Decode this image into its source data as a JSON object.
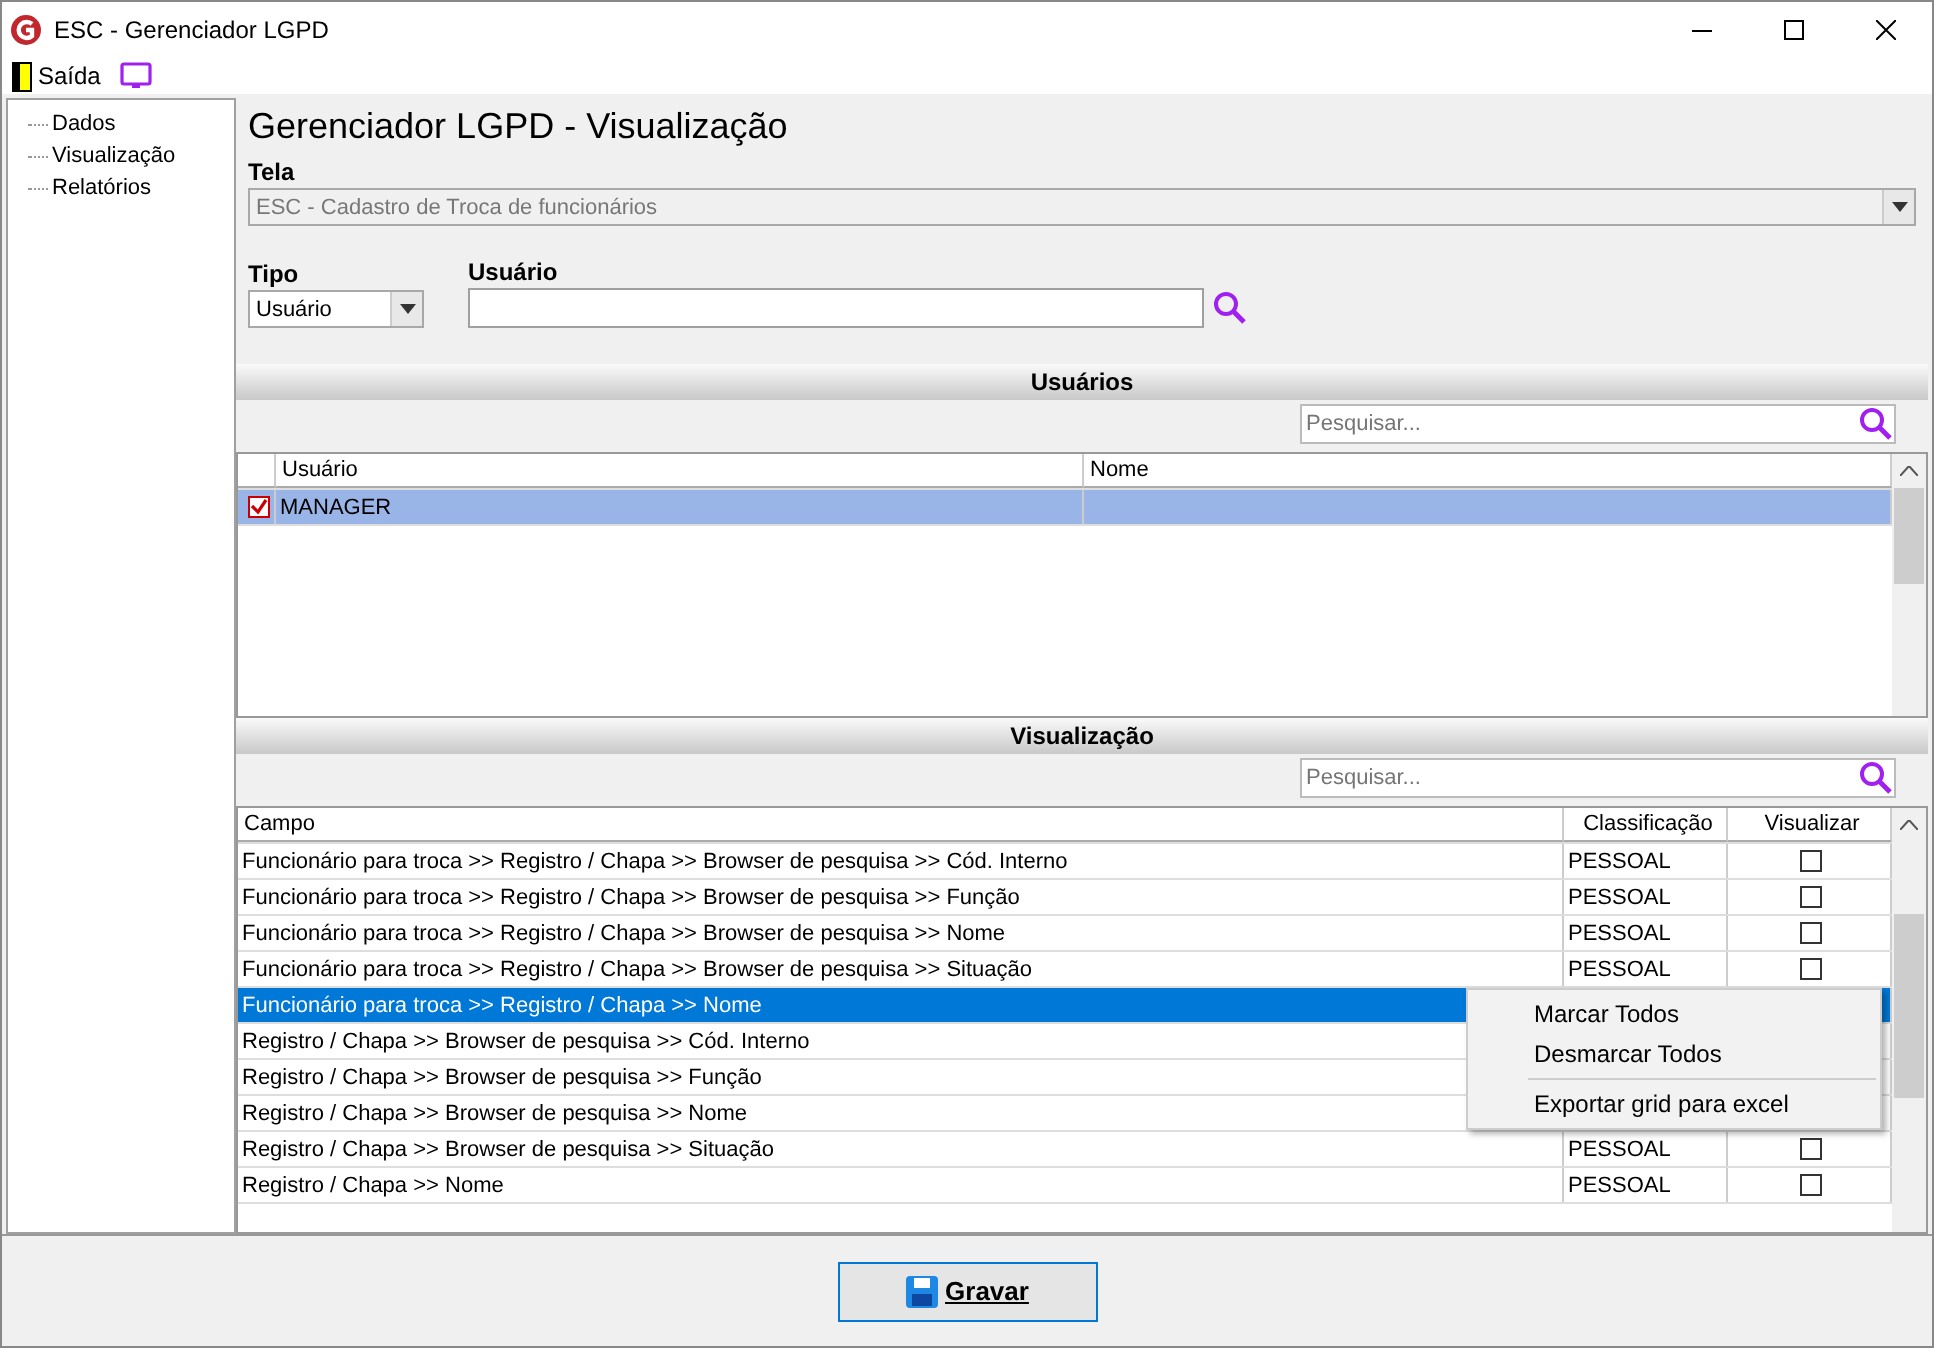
{
  "window": {
    "title": "ESC - Gerenciador LGPD"
  },
  "menu": {
    "label": "Saída"
  },
  "sidebar": {
    "items": [
      {
        "label": "Dados"
      },
      {
        "label": "Visualização"
      },
      {
        "label": "Relatórios"
      }
    ]
  },
  "page_title": "Gerenciador LGPD - Visualização",
  "tela": {
    "label": "Tela",
    "value": "ESC - Cadastro de Troca de funcionários",
    "disabled": true
  },
  "tipo": {
    "label": "Tipo",
    "value": "Usuário"
  },
  "usuario": {
    "label": "Usuário"
  },
  "usuarios": {
    "title": "Usuários",
    "search": {
      "placeholder": "Pesquisar..."
    },
    "columns": [
      "Usuário",
      "Nome"
    ],
    "rows": [
      {
        "usuario": "MANAGER",
        "checked": true,
        "selected": true
      }
    ]
  },
  "visualizacao": {
    "title": "Visualização",
    "search": {
      "placeholder": "Pesquisar..."
    },
    "columns": [
      "Campo",
      "Classificação",
      "Visualizar"
    ],
    "rows": [
      {
        "campo": "Funcionário para troca >> Registro / Chapa  >> Browser de pesquisa >> Cód. Interno",
        "classificacao": "PESSOAL",
        "checked": false,
        "selected": false
      },
      {
        "campo": "Funcionário para troca >> Registro / Chapa  >> Browser de pesquisa >> Função",
        "classificacao": "PESSOAL",
        "checked": false,
        "selected": false
      },
      {
        "campo": "Funcionário para troca >> Registro / Chapa  >> Browser de pesquisa >> Nome",
        "classificacao": "PESSOAL",
        "checked": false,
        "selected": false
      },
      {
        "campo": "Funcionário para troca >> Registro / Chapa  >> Browser de pesquisa >> Situação",
        "classificacao": "PESSOAL",
        "checked": false,
        "selected": false
      },
      {
        "campo": "Funcionário para troca >> Registro / Chapa >> Nome",
        "selected": true
      },
      {
        "campo": "Registro / Chapa >> Browser de pesquisa >> Cód. Interno",
        "selected": false
      },
      {
        "campo": "Registro / Chapa >> Browser de pesquisa >> Função",
        "selected": false
      },
      {
        "campo": "Registro / Chapa >> Browser de pesquisa >> Nome",
        "selected": false
      },
      {
        "campo": "Registro / Chapa >> Browser de pesquisa >> Situação",
        "classificacao": "PESSOAL",
        "checked": false,
        "selected": false
      },
      {
        "campo": "Registro / Chapa >> Nome",
        "classificacao": "PESSOAL",
        "checked": false,
        "selected": false
      }
    ]
  },
  "context_menu": {
    "groups": [
      [
        "Marcar Todos",
        "Desmarcar Todos"
      ],
      [
        "Exportar grid para excel"
      ]
    ]
  },
  "save_button": {
    "label": "Gravar"
  }
}
